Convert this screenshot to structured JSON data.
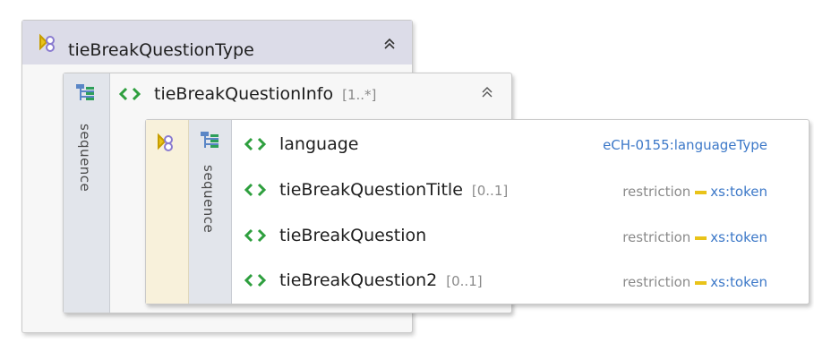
{
  "colors": {
    "type_header_bg": "#dcdce8",
    "type_strip_bg": "#f8f1db",
    "sequence_strip_bg": "#e2e5eb",
    "type_link": "#3c78c8",
    "restriction_marker": "#e9c319"
  },
  "complex_type": {
    "name": "tieBreakQuestionType",
    "icon": "complex-type-icon",
    "collapse_icon": "double-chevron-up-icon"
  },
  "outer_sequence": {
    "label": "sequence",
    "icon": "sequence-icon"
  },
  "element": {
    "name": "tieBreakQuestionInfo",
    "multiplicity": "[1..*]",
    "icon": "element-icon",
    "collapse_icon": "double-chevron-up-icon"
  },
  "inner_sequence": {
    "label": "sequence",
    "icon": "sequence-icon"
  },
  "children": [
    {
      "name": "language",
      "multiplicity": "",
      "restriction": "",
      "type": "eCH-0155:languageType"
    },
    {
      "name": "tieBreakQuestionTitle",
      "multiplicity": "[0..1]",
      "restriction": "restriction",
      "type": "xs:token"
    },
    {
      "name": "tieBreakQuestion",
      "multiplicity": "",
      "restriction": "restriction",
      "type": "xs:token"
    },
    {
      "name": "tieBreakQuestion2",
      "multiplicity": "[0..1]",
      "restriction": "restriction",
      "type": "xs:token"
    }
  ]
}
